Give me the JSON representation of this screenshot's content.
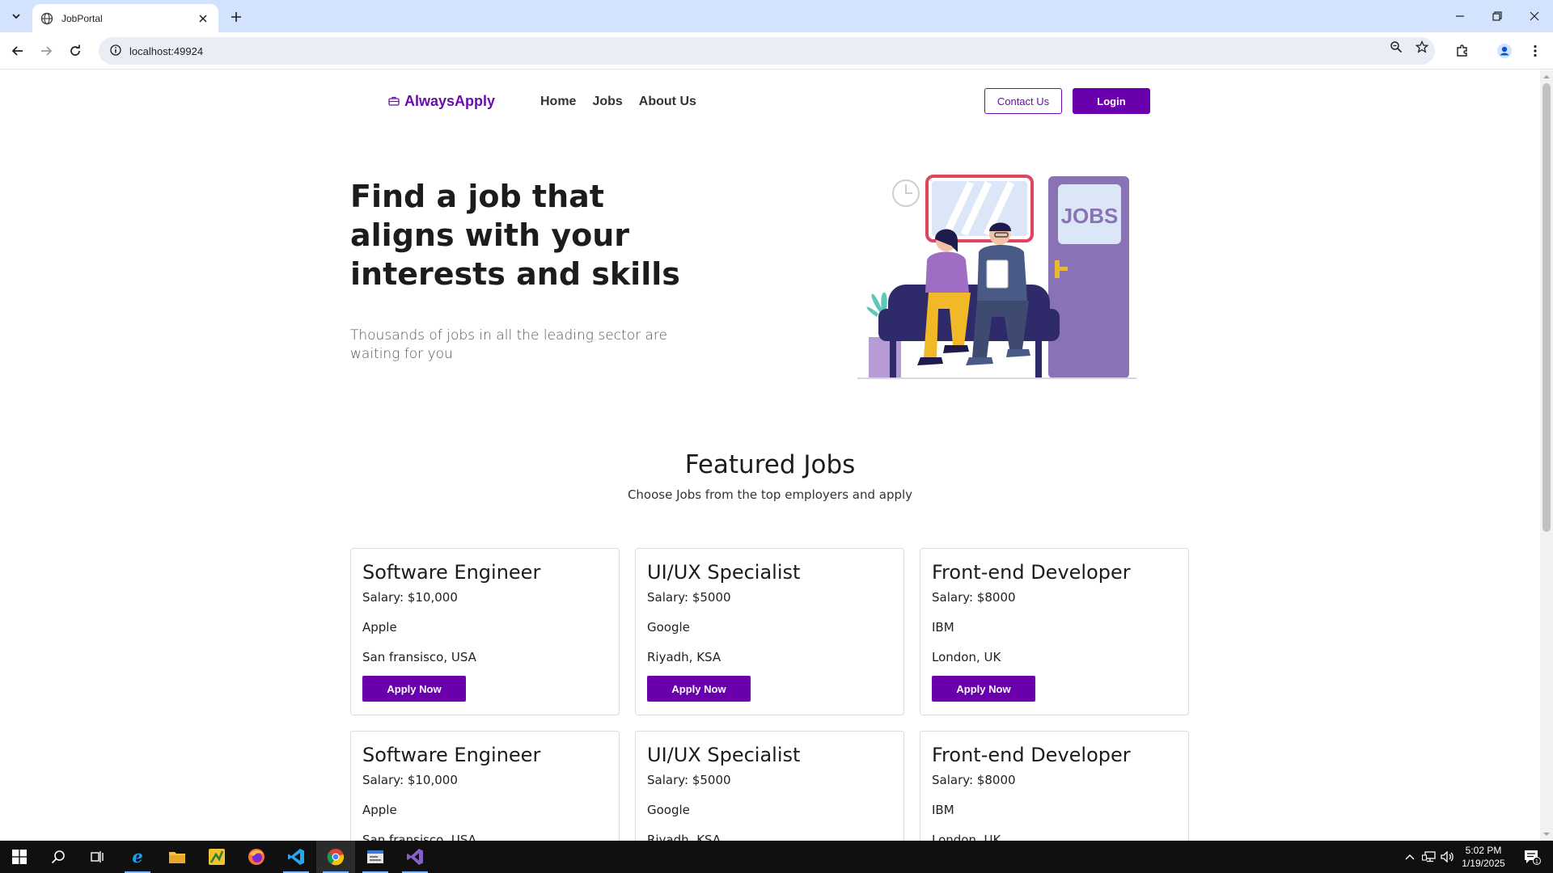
{
  "browser": {
    "tab_title": "JobPortal",
    "url": "localhost:49924"
  },
  "nav": {
    "brand": "AlwaysApply",
    "links": [
      "Home",
      "Jobs",
      "About Us"
    ],
    "contact_label": "Contact Us",
    "login_label": "Login"
  },
  "hero": {
    "title": "Find a job that aligns with your interests and skills",
    "subtitle": "Thousands of jobs in all the leading sector are waiting for you",
    "illustration_sign": "JOBS"
  },
  "featured": {
    "title": "Featured Jobs",
    "subtitle": "Choose Jobs from the top employers and apply",
    "apply_label": "Apply Now",
    "jobs": [
      {
        "title": "Software Engineer",
        "salary": "Salary: $10,000",
        "company": "Apple",
        "location": "San fransisco, USA"
      },
      {
        "title": "UI/UX Specialist",
        "salary": "Salary: $5000",
        "company": "Google",
        "location": "Riyadh, KSA"
      },
      {
        "title": "Front-end Developer",
        "salary": "Salary: $8000",
        "company": "IBM",
        "location": "London, UK"
      },
      {
        "title": "Software Engineer",
        "salary": "Salary: $10,000",
        "company": "Apple",
        "location": "San fransisco, USA"
      },
      {
        "title": "UI/UX Specialist",
        "salary": "Salary: $5000",
        "company": "Google",
        "location": "Riyadh, KSA"
      },
      {
        "title": "Front-end Developer",
        "salary": "Salary: $8000",
        "company": "IBM",
        "location": "London, UK"
      }
    ]
  },
  "taskbar": {
    "time": "5:02 PM",
    "date": "1/19/2025",
    "notification_count": "1"
  },
  "colors": {
    "brand_purple": "#6a00ad",
    "tabstrip": "#d3e3fd"
  }
}
